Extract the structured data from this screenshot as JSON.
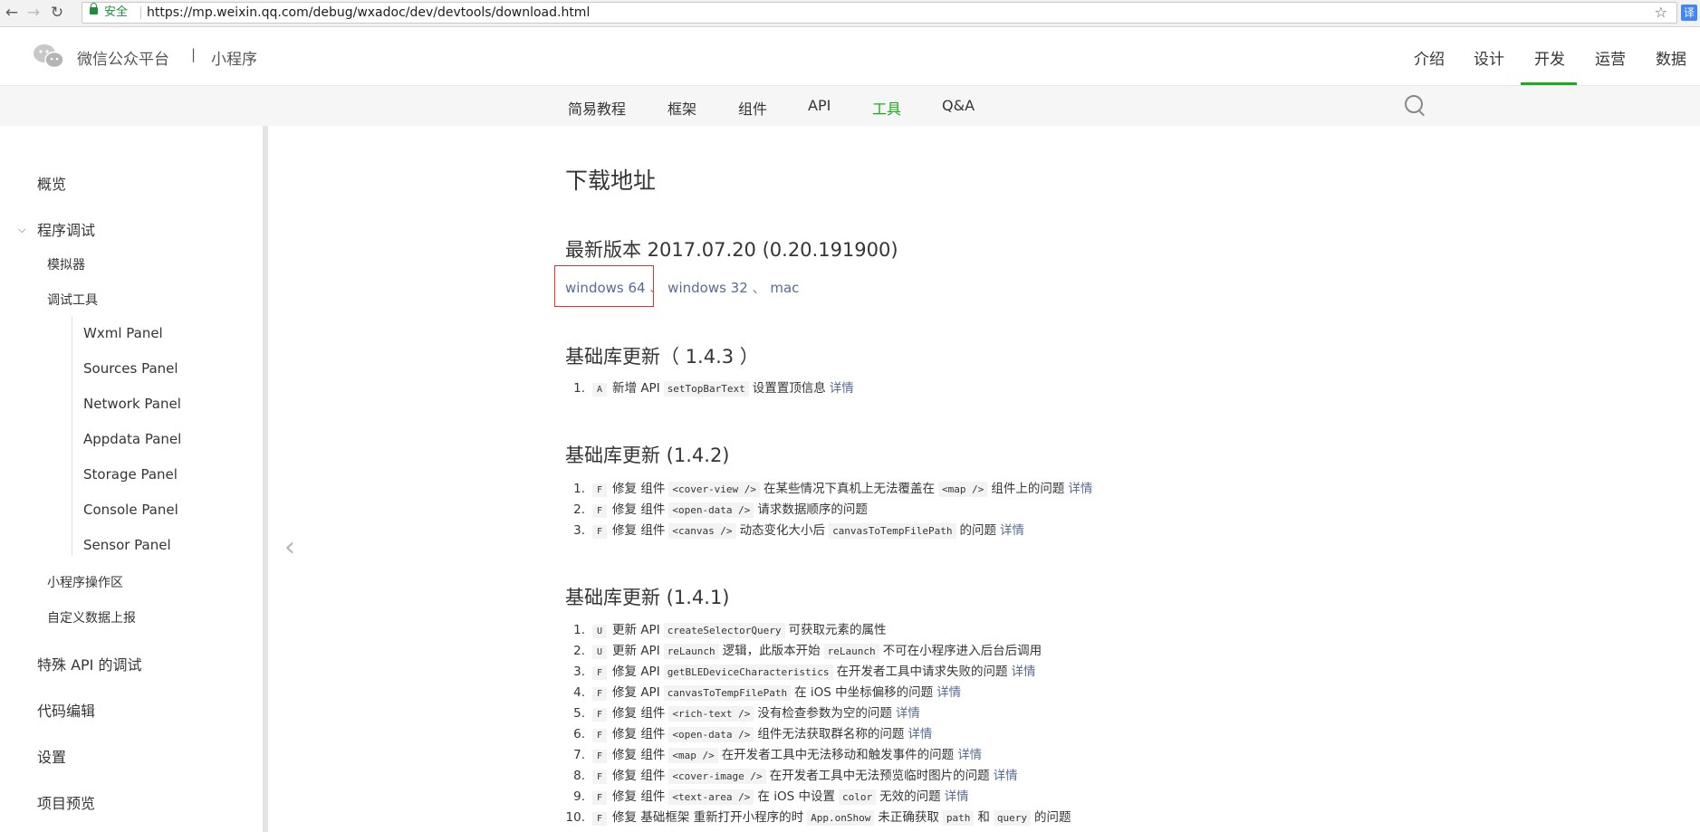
{
  "browser": {
    "secure_label": "安全",
    "url": "https://mp.weixin.qq.com/debug/wxadoc/dev/devtools/download.html",
    "translate_label": "译"
  },
  "header": {
    "brand": "微信公众平台",
    "separator": "|",
    "sub_brand": "小程序",
    "nav": [
      "介绍",
      "设计",
      "开发",
      "运营",
      "数据"
    ],
    "active_nav": "开发"
  },
  "subnav": {
    "items": [
      "简易教程",
      "框架",
      "组件",
      "API",
      "工具",
      "Q&A"
    ],
    "active": "工具"
  },
  "sidebar": {
    "items": [
      {
        "label": "概览",
        "level": 1
      },
      {
        "label": "程序调试",
        "level": 1,
        "expanded": true
      },
      {
        "label": "模拟器",
        "level": 2
      },
      {
        "label": "调试工具",
        "level": 2
      },
      {
        "label": "Wxml Panel",
        "level": 3
      },
      {
        "label": "Sources Panel",
        "level": 3
      },
      {
        "label": "Network Panel",
        "level": 3
      },
      {
        "label": "Appdata Panel",
        "level": 3
      },
      {
        "label": "Storage Panel",
        "level": 3
      },
      {
        "label": "Console Panel",
        "level": 3
      },
      {
        "label": "Sensor Panel",
        "level": 3
      },
      {
        "label": "小程序操作区",
        "level": 2
      },
      {
        "label": "自定义数据上报",
        "level": 2
      },
      {
        "label": "特殊 API 的调试",
        "level": 1
      },
      {
        "label": "代码编辑",
        "level": 1
      },
      {
        "label": "设置",
        "level": 1
      },
      {
        "label": "项目预览",
        "level": 1
      }
    ]
  },
  "content": {
    "title": "下载地址",
    "latest_heading": "最新版本 2017.07.20 (0.20.191900)",
    "downloads": [
      "windows 64",
      "windows 32",
      "mac"
    ],
    "download_sep": "、",
    "detail": "详情",
    "sections": [
      {
        "heading": "基础库更新（ 1.4.3 ）",
        "items": [
          {
            "num": "1.",
            "tag": "A",
            "parts": [
              [
                "t",
                "新增 API"
              ],
              [
                "c",
                "setTopBarText"
              ],
              [
                "t",
                "设置置顶信息"
              ]
            ],
            "detail": true
          }
        ]
      },
      {
        "heading": "基础库更新 (1.4.2)",
        "items": [
          {
            "num": "1.",
            "tag": "F",
            "parts": [
              [
                "t",
                "修复 组件"
              ],
              [
                "c",
                "<cover-view />"
              ],
              [
                "t",
                "在某些情况下真机上无法覆盖在"
              ],
              [
                "c",
                "<map />"
              ],
              [
                "t",
                "组件上的问题"
              ]
            ],
            "detail": true
          },
          {
            "num": "2.",
            "tag": "F",
            "parts": [
              [
                "t",
                "修复 组件"
              ],
              [
                "c",
                "<open-data />"
              ],
              [
                "t",
                "请求数据顺序的问题"
              ]
            ],
            "detail": false
          },
          {
            "num": "3.",
            "tag": "F",
            "parts": [
              [
                "t",
                "修复 组件"
              ],
              [
                "c",
                "<canvas />"
              ],
              [
                "t",
                "动态变化大小后"
              ],
              [
                "c",
                "canvasToTempFilePath"
              ],
              [
                "t",
                "的问题"
              ]
            ],
            "detail": true
          }
        ]
      },
      {
        "heading": "基础库更新 (1.4.1)",
        "items": [
          {
            "num": "1.",
            "tag": "U",
            "parts": [
              [
                "t",
                "更新 API"
              ],
              [
                "c",
                "createSelectorQuery"
              ],
              [
                "t",
                "可获取元素的属性"
              ]
            ],
            "detail": false
          },
          {
            "num": "2.",
            "tag": "U",
            "parts": [
              [
                "t",
                "更新 API"
              ],
              [
                "c",
                "reLaunch"
              ],
              [
                "t",
                "逻辑，此版本开始"
              ],
              [
                "c",
                "reLaunch"
              ],
              [
                "t",
                "不可在小程序进入后台后调用"
              ]
            ],
            "detail": false
          },
          {
            "num": "3.",
            "tag": "F",
            "parts": [
              [
                "t",
                "修复 API"
              ],
              [
                "c",
                "getBLEDeviceCharacteristics"
              ],
              [
                "t",
                "在开发者工具中请求失败的问题"
              ]
            ],
            "detail": true
          },
          {
            "num": "4.",
            "tag": "F",
            "parts": [
              [
                "t",
                "修复 API"
              ],
              [
                "c",
                "canvasToTempFilePath"
              ],
              [
                "t",
                "在 iOS 中坐标偏移的问题"
              ]
            ],
            "detail": true
          },
          {
            "num": "5.",
            "tag": "F",
            "parts": [
              [
                "t",
                "修复 组件"
              ],
              [
                "c",
                "<rich-text />"
              ],
              [
                "t",
                "没有检查参数为空的问题"
              ]
            ],
            "detail": true
          },
          {
            "num": "6.",
            "tag": "F",
            "parts": [
              [
                "t",
                "修复 组件"
              ],
              [
                "c",
                "<open-data />"
              ],
              [
                "t",
                "组件无法获取群名称的问题"
              ]
            ],
            "detail": true
          },
          {
            "num": "7.",
            "tag": "F",
            "parts": [
              [
                "t",
                "修复 组件"
              ],
              [
                "c",
                "<map />"
              ],
              [
                "t",
                "在开发者工具中无法移动和触发事件的问题"
              ]
            ],
            "detail": true
          },
          {
            "num": "8.",
            "tag": "F",
            "parts": [
              [
                "t",
                "修复 组件"
              ],
              [
                "c",
                "<cover-image />"
              ],
              [
                "t",
                "在开发者工具中无法预览临时图片的问题"
              ]
            ],
            "detail": true
          },
          {
            "num": "9.",
            "tag": "F",
            "parts": [
              [
                "t",
                "修复 组件"
              ],
              [
                "c",
                "<text-area />"
              ],
              [
                "t",
                "在 iOS 中设置"
              ],
              [
                "c",
                "color"
              ],
              [
                "t",
                "无效的问题"
              ]
            ],
            "detail": true
          },
          {
            "num": "10.",
            "tag": "F",
            "parts": [
              [
                "t",
                "修复 基础框架 重新打开小程序的时"
              ],
              [
                "c",
                "App.onShow"
              ],
              [
                "t",
                "未正确获取"
              ],
              [
                "c",
                "path"
              ],
              [
                "t",
                "和"
              ],
              [
                "c",
                "query"
              ],
              [
                "t",
                "的问题"
              ]
            ],
            "detail": false
          }
        ]
      }
    ]
  },
  "colors": {
    "accent": "#1aad19",
    "link": "#576b95",
    "highlight_box": "#e03131"
  }
}
